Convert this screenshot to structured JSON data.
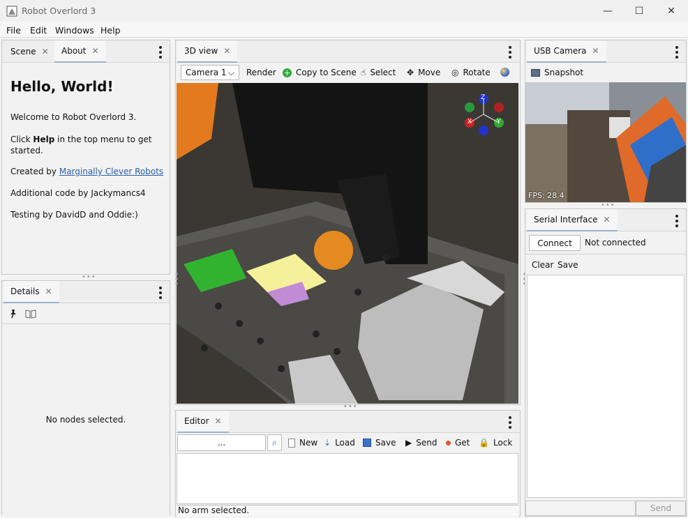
{
  "window": {
    "title": "Robot Overlord 3",
    "minimize": "—",
    "maximize": "☐",
    "close": "✕"
  },
  "menu": {
    "items": [
      "File",
      "Edit",
      "Windows",
      "Help"
    ]
  },
  "left_top": {
    "tabs": [
      {
        "label": "Scene"
      },
      {
        "label": "About"
      }
    ],
    "heading": "Hello, World!",
    "welcome": "Welcome to Robot Overlord 3.",
    "help_pre": "Click ",
    "help_bold": "Help",
    "help_post": " in the top menu to get started.",
    "created_pre": "Created by ",
    "created_link": "Marginally Clever Robots",
    "additional": "Additional code by Jackymancs4",
    "testing": "Testing by DavidD and Oddie:)"
  },
  "details": {
    "tab": "Details",
    "empty_text": "No nodes selected."
  },
  "view3d": {
    "tab": "3D view",
    "camera_select": "Camera 1",
    "render": "Render",
    "copy_to_scene": "Copy to Scene",
    "select": "Select",
    "move": "Move",
    "rotate": "Rotate",
    "axes": {
      "z": "Z",
      "y": "Y",
      "x": "X"
    }
  },
  "editor": {
    "tab": "Editor",
    "input_value": "...",
    "new": "New",
    "load": "Load",
    "save": "Save",
    "send": "Send",
    "get": "Get",
    "lock": "Lock",
    "status": "No arm selected."
  },
  "usb_camera": {
    "tab": "USB Camera",
    "snapshot": "Snapshot",
    "fps": "FPS: 28.4"
  },
  "serial": {
    "tab": "Serial Interface",
    "connect": "Connect",
    "status": "Not connected",
    "clear": "Clear",
    "save": "Save",
    "send": "Send"
  },
  "colors": {
    "accent_tab": "#9ab3cc",
    "link": "#2a5fa8",
    "green_icon": "#2faa3c"
  }
}
